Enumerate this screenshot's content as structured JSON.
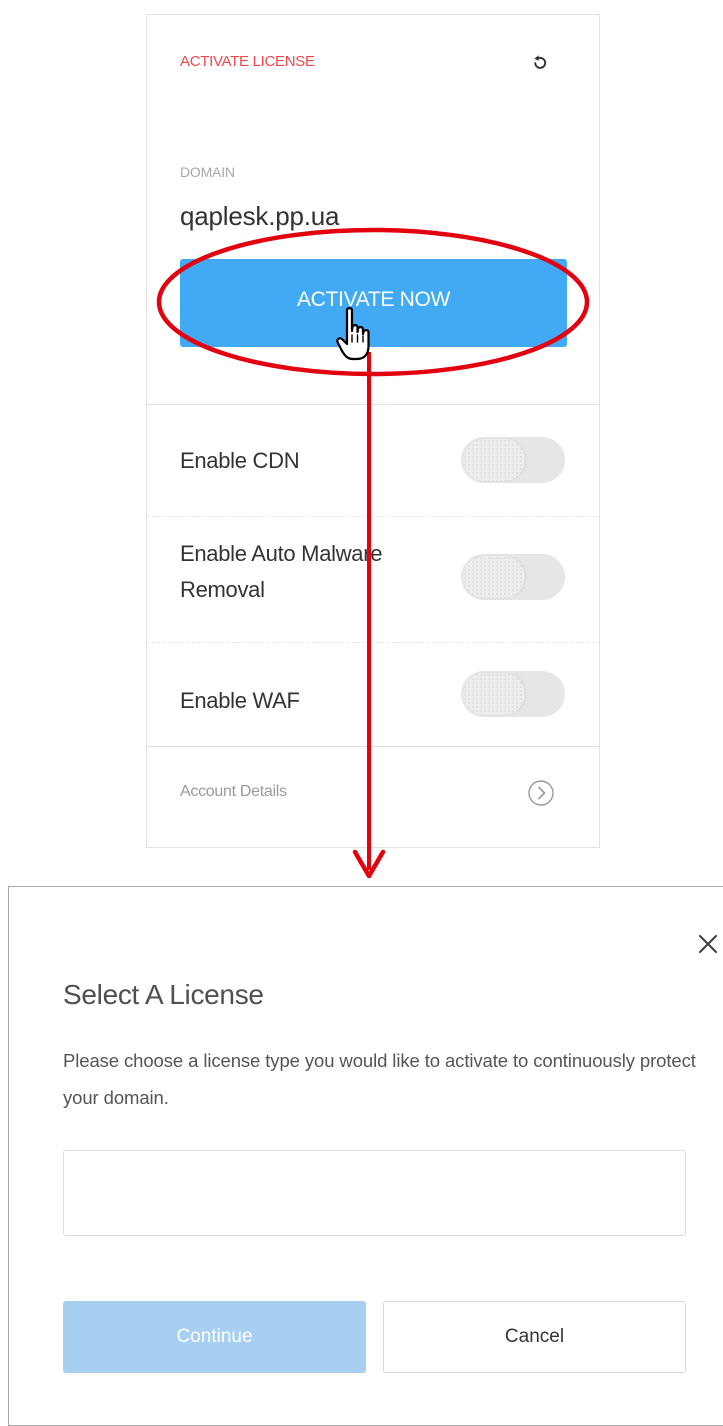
{
  "card": {
    "title": "ACTIVATE LICENSE",
    "refresh_icon": "refresh-icon",
    "domain_label": "DOMAIN",
    "domain_value": "qaplesk.pp.ua",
    "activate_label": "ACTIVATE NOW",
    "options": [
      {
        "label": "Enable CDN",
        "enabled": false
      },
      {
        "label": "Enable Auto Malware Removal",
        "enabled": false
      },
      {
        "label": "Enable WAF",
        "enabled": false
      }
    ],
    "account_label": "Account Details",
    "account_icon": "chevron-right-circle-icon"
  },
  "dialog": {
    "title": "Select A License",
    "description": "Please choose a license type you would like to activate to continuously protect your domain.",
    "license_value": "",
    "continue_label": "Continue",
    "cancel_label": "Cancel",
    "close_icon": "close-icon"
  },
  "colors": {
    "accent_red": "#f0474e",
    "primary_blue": "#42aaf4",
    "disabled_blue": "#a6cff2",
    "annotation_red": "#e3000f"
  }
}
